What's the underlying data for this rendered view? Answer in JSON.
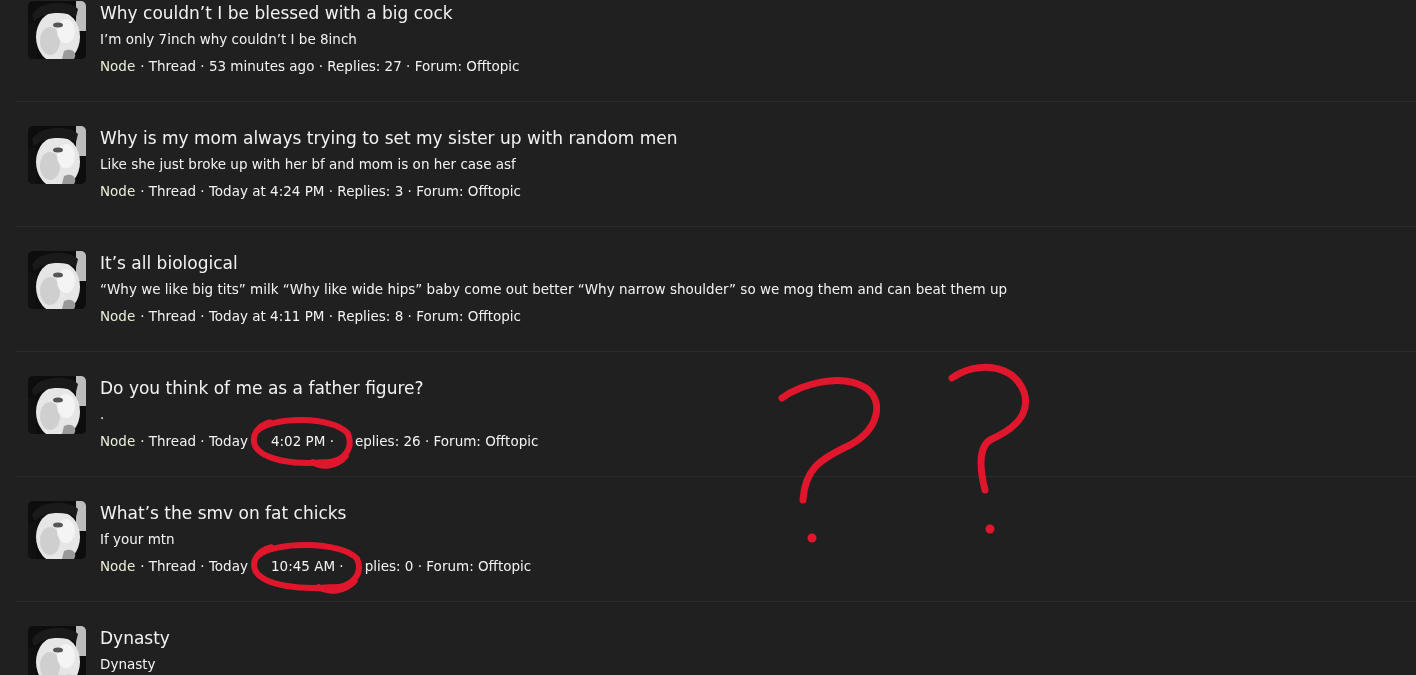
{
  "results": [
    {
      "title": "Why couldn’t I be blessed with a big cock",
      "snippet": "I’m only 7inch why couldn’t I be 8inch",
      "meta": {
        "node": "Node",
        "parts": [
          {
            "text": "· Thread · 53 minutes ago · Replies: 27 · Forum: Offtopic",
            "circled": false
          }
        ]
      }
    },
    {
      "title": "Why is my mom always trying to set my sister up with random men",
      "snippet": "Like she just broke up with her bf and mom is on her case asf",
      "meta": {
        "node": "Node",
        "parts": [
          {
            "text": "· Thread · Today at 4:24 PM · Replies: 3 · Forum: Offtopic",
            "circled": false
          }
        ]
      }
    },
    {
      "title": "It’s all biological",
      "snippet": "“Why we like big tits” milk “Why like wide hips” baby come out better “Why narrow shoulder” so we mog them and can beat them up",
      "meta": {
        "node": "Node",
        "parts": [
          {
            "text": "· Thread · Today at 4:11 PM · Replies: 8 · Forum: Offtopic",
            "circled": false
          }
        ]
      }
    },
    {
      "title": "Do you think of me as a father figure?",
      "snippet": ".",
      "meta": {
        "node": "Node",
        "parts": [
          {
            "text": "· Thread · Today",
            "circled": false
          },
          {
            "text": "4:02 PM ·",
            "circled": true
          },
          {
            "text": "eplies: 26 · Forum: Offtopic",
            "circled": false
          }
        ]
      }
    },
    {
      "title": "What’s the smv on fat chicks",
      "snippet": "If your mtn",
      "meta": {
        "node": "Node",
        "parts": [
          {
            "text": "· Thread · Today",
            "circled": false
          },
          {
            "text": "10:45 AM ·",
            "circled": true
          },
          {
            "text": "plies: 0 · Forum: Offtopic",
            "circled": false
          }
        ]
      }
    },
    {
      "title": "Dynasty",
      "snippet": "Dynasty"
    }
  ],
  "scribbles": [
    {
      "kind": "question_mark"
    },
    {
      "kind": "question_mark"
    }
  ]
}
